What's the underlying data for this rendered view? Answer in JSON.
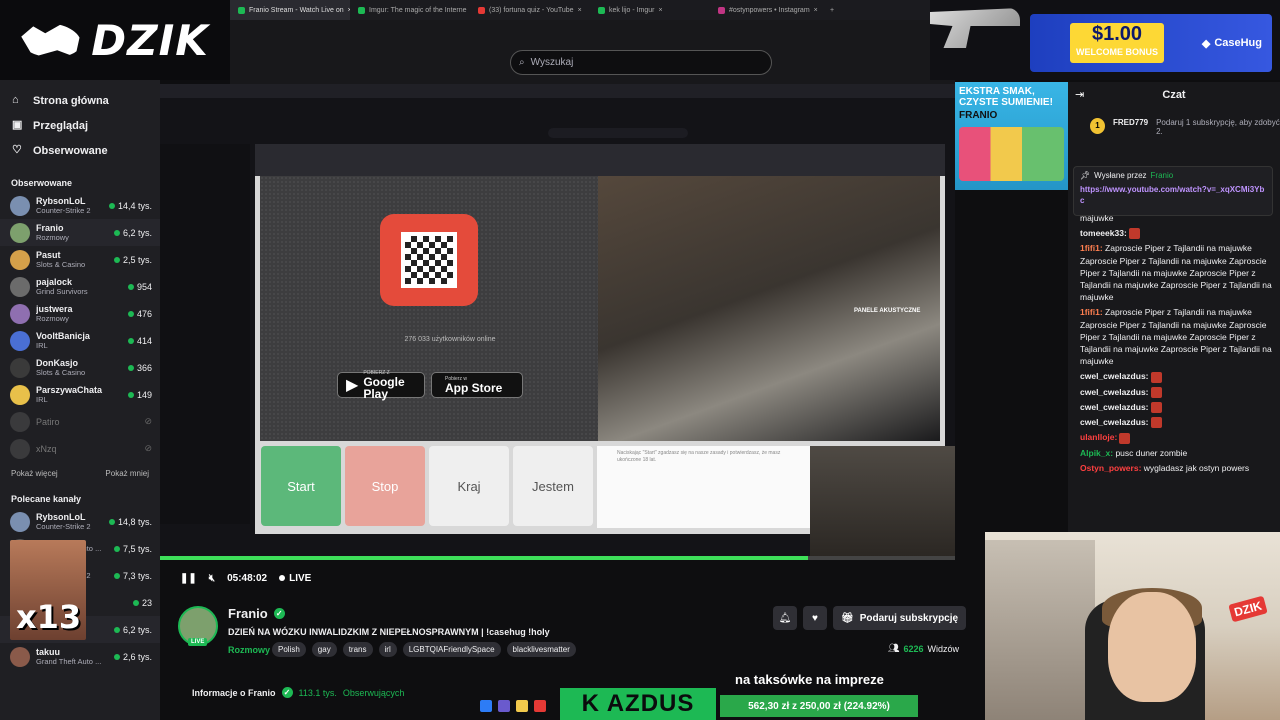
{
  "logo": {
    "text": "DZIK"
  },
  "browser_tabs": [
    {
      "label": "Franio Stream - Watch Live on",
      "color": "#1db954",
      "active": true
    },
    {
      "label": "Imgur: The magic of the Interne",
      "color": "#1db954"
    },
    {
      "label": "(33) fortuna quiz - YouTube",
      "color": "#e53935"
    },
    {
      "label": "kek lijo - Imgur",
      "color": "#1db954"
    },
    {
      "label": "#ostynpowers • Instagram",
      "color": "#c13584"
    }
  ],
  "window_controls": [
    "–",
    "□",
    "✕"
  ],
  "search": {
    "placeholder": "Wyszukaj"
  },
  "nav": [
    {
      "label": "Strona główna",
      "icon": "home-icon",
      "glyph": "⌂"
    },
    {
      "label": "Przeglądaj",
      "icon": "browse-icon",
      "glyph": "▣"
    },
    {
      "label": "Obserwowane",
      "icon": "heart-icon",
      "glyph": "♡"
    }
  ],
  "followed": {
    "heading": "Obserwowane",
    "channels": [
      {
        "name": "RybsonLoL",
        "category": "Counter-Strike 2",
        "viewers": "14,4 tys.",
        "color": "#7a8fb0"
      },
      {
        "name": "Franio",
        "category": "Rozmowy",
        "viewers": "6,2 tys.",
        "color": "#7da06d",
        "selected": true
      },
      {
        "name": "Pasut",
        "category": "Slots & Casino",
        "viewers": "2,5 tys.",
        "color": "#d4a04a"
      },
      {
        "name": "pajalock",
        "category": "Grind Survivors",
        "viewers": "954",
        "color": "#6b6b6b"
      },
      {
        "name": "justwera",
        "category": "Rozmowy",
        "viewers": "476",
        "color": "#8f6fb0"
      },
      {
        "name": "VooltBanicja",
        "category": "IRL",
        "viewers": "414",
        "color": "#4a6fd4"
      },
      {
        "name": "DonKasjo",
        "category": "Slots & Casino",
        "viewers": "366",
        "color": "#3a3a3a"
      },
      {
        "name": "ParszywaChata",
        "category": "IRL",
        "viewers": "149",
        "color": "#e8c04a"
      },
      {
        "name": "Patiro",
        "category": "",
        "viewers": "",
        "color": "#555",
        "offline": true
      },
      {
        "name": "xNzq",
        "category": "",
        "viewers": "",
        "color": "#555",
        "offline": true
      }
    ],
    "show_more": "Pokaż więcej",
    "show_less": "Pokaż mniej"
  },
  "recommended": {
    "heading": "Polecane kanały",
    "channels": [
      {
        "name": "RybsonLoL",
        "category": "Counter-Strike 2",
        "viewers": "14,8 tys.",
        "color": "#7a8fb0"
      },
      {
        "name": "",
        "category": "Grand Theft Auto ...",
        "viewers": "7,5 tys.",
        "color": "#555"
      },
      {
        "name": "",
        "category": "Counter-Strike 2",
        "viewers": "7,3 tys.",
        "color": "#555"
      },
      {
        "name": "",
        "category": "Slots & Casino",
        "viewers": "23",
        "color": "#555"
      },
      {
        "name": "Franio",
        "category": "Rozmowy",
        "viewers": "6,2 tys.",
        "color": "#7da06d",
        "selected": true
      },
      {
        "name": "takuu",
        "category": "Grand Theft Auto ...",
        "viewers": "2,6 tys.",
        "color": "#8a5a4a"
      }
    ]
  },
  "emote_overlay": {
    "text": "x13"
  },
  "video": {
    "ometv_online": "276 033 użytkowników online",
    "google_play_small": "POBIERZ Z",
    "google_play": "Google Play",
    "app_store_small": "Pobierz w",
    "app_store": "App Store",
    "cam_label": "PANELE AKUSTYCZNE",
    "btn_start": "Start",
    "btn_stop": "Stop",
    "btn_kraj": "Kraj",
    "btn_jestem": "Jestem",
    "chat_notice": "Naciskając \"Start\" zgadzasz się na nasze zasady i potwierdzasz, że masz ukończone 18 lat.",
    "progress_fraction": 0.815
  },
  "player": {
    "time": "05:48:02",
    "live_label": "LIVE"
  },
  "stream": {
    "name": "Franio",
    "live_badge": "LIVE",
    "title": "DZIEŃ NA WÓZKU INWALIDZKIM Z NIEPEŁNOSPRAWNYM | !casehug !holy",
    "category": "Rozmowy",
    "tags": [
      "Polish",
      "gay",
      "trans",
      "irl",
      "LGBTQIAFriendlySpace",
      "blacklivesmatter"
    ],
    "subscribe": "Podaruj subskrypcję",
    "viewers": "6226",
    "viewers_label": "Widzów",
    "about": "Informacje o Franio",
    "followers": "113.1 tys.",
    "followers_label": "Obserwujących"
  },
  "ticker": {
    "text": "K AZDUS",
    "taxi": "na taksówke na impreze",
    "money": "562,30 zł z 250,00 zł (224.92%)"
  },
  "ads": {
    "amount": "$1.00",
    "bonus": "WELCOME BONUS",
    "brand": "CaseHug",
    "frank_line1": "EKSTRA SMAK, CZYSTE SUMIENIE!",
    "frank_brand": "FRANIO"
  },
  "chat": {
    "title": "Czat",
    "sub_user": "FRED779",
    "sub_badge": "1",
    "sub_text": "Podaruj 1 subskrypcję, aby zdobyć 2.",
    "pinned_by": "Wysłane przez",
    "pinned_user": "Franio",
    "pinned_link": "https://www.youtube.com/watch?v=_xqXCMi3Ybc",
    "messages": [
      {
        "user": "",
        "text": "majuwke",
        "color": "#efeff1"
      },
      {
        "user": "tomeeek33:",
        "text": "",
        "color": "#efeff1",
        "emote": true
      },
      {
        "user": "1fifi1:",
        "text": "Zaproscie Piper z Tajlandii na majuwke Zaproscie Piper z Tajlandii na majuwke Zaproscie Piper z Tajlandii na majuwke Zaproscie Piper z Tajlandii na majuwke Zaproscie Piper z Tajlandii na majuwke",
        "color": "#ff7f50"
      },
      {
        "user": "1fifi1:",
        "text": "Zaproscie Piper z Tajlandii na majuwke Zaproscie Piper z Tajlandii na majuwke Zaproscie Piper z Tajlandii na majuwke Zaproscie Piper z Tajlandii na majuwke Zaproscie Piper z Tajlandii na majuwke",
        "color": "#ff7f50"
      },
      {
        "user": "cwel_cwelazdus:",
        "text": "",
        "color": "#efeff1",
        "emote": true
      },
      {
        "user": "cwel_cwelazdus:",
        "text": "",
        "color": "#efeff1",
        "emote": true
      },
      {
        "user": "cwel_cwelazdus:",
        "text": "",
        "color": "#efeff1",
        "emote": true
      },
      {
        "user": "cwel_cwelazdus:",
        "text": "",
        "color": "#efeff1",
        "emote": true
      },
      {
        "user": "ulanlloje:",
        "text": "",
        "color": "#ff4040",
        "emote": true
      },
      {
        "user": "Alpik_x:",
        "text": "pusc duner zombie",
        "color": "#1db954"
      },
      {
        "user": "Ostyn_powers:",
        "text": "wygladasz jak ostyn powers",
        "color": "#ff4040"
      }
    ]
  }
}
